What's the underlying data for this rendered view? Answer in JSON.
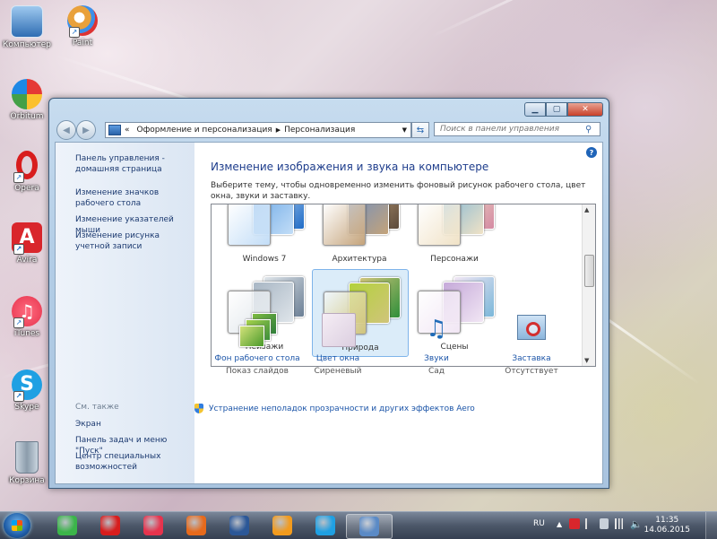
{
  "desktop": {
    "icons": [
      {
        "label": "Компьютер",
        "color": "#4a86c8"
      },
      {
        "label": "Paint",
        "color": "#e9a13b"
      },
      {
        "label": "Orbitum",
        "color": "#3bb54a"
      },
      {
        "label": "Opera",
        "color": "#d81d1d"
      },
      {
        "label": "Avira",
        "color": "#d9262c"
      },
      {
        "label": "iTunes",
        "color": "#e6334d"
      },
      {
        "label": "Skype",
        "color": "#1fa0e3"
      },
      {
        "label": "Корзина",
        "color": "#8b9cab"
      }
    ]
  },
  "window": {
    "address": {
      "chevrons": "«",
      "path1": "Оформление и персонализация",
      "sep": "▶",
      "path2": "Персонализация"
    },
    "search_placeholder": "Поиск в панели управления",
    "left_links": {
      "home": "Панель управления - домашняя страница",
      "icons": "Изменение значков рабочего стола",
      "pointers": "Изменение указателей мыши",
      "account": "Изменение рисунка учетной записи"
    },
    "see_also": {
      "title": "См. также",
      "screen": "Экран",
      "taskbar": "Панель задач и меню \"Пуск\"",
      "access": "Центр специальных возможностей"
    },
    "heading": "Изменение изображения и звука на компьютере",
    "description": "Выберите тему, чтобы одновременно изменить фоновый рисунок рабочего стола, цвет окна, звуки и заставку.",
    "themes": [
      {
        "name": "Windows 7",
        "colors": [
          "#1f6bc6",
          "#6aa7e6",
          "#c2ddf7"
        ],
        "selected": false
      },
      {
        "name": "Архитектура",
        "colors": [
          "#5b4a3b",
          "#6d8fc2",
          "#c4a37a"
        ],
        "selected": false
      },
      {
        "name": "Персонажи",
        "colors": [
          "#d48aa3",
          "#7fb6d6",
          "#f0e2c6"
        ],
        "selected": false
      },
      {
        "name": "Пейзажи",
        "colors": [
          "#6b7f95",
          "#a8b6c4",
          "#dfe5ea"
        ],
        "selected": false
      },
      {
        "name": "Природа",
        "colors": [
          "#2f8f3a",
          "#b3d23c",
          "#d0c47a"
        ],
        "selected": true
      },
      {
        "name": "Сцены",
        "colors": [
          "#7bb7d9",
          "#c5a9d9",
          "#f1e6f4"
        ],
        "selected": false
      }
    ],
    "options": [
      {
        "label": "Фон рабочего стола",
        "sub": "Показ слайдов",
        "icon": "desktop-background-icon"
      },
      {
        "label": "Цвет окна",
        "sub": "Сиреневый",
        "icon": "window-color-icon"
      },
      {
        "label": "Звуки",
        "sub": "Сад",
        "icon": "sounds-icon"
      },
      {
        "label": "Заставка",
        "sub": "Отсутствует",
        "icon": "screensaver-icon"
      }
    ],
    "aero_link": "Устранение неполадок прозрачности и других эффектов Aero"
  },
  "taskbar": {
    "items": [
      {
        "name": "orbitum",
        "color": "#3bb54a",
        "active": false
      },
      {
        "name": "opera",
        "color": "#d81d1d",
        "active": false
      },
      {
        "name": "itunes",
        "color": "#e6334d",
        "active": false
      },
      {
        "name": "outlook",
        "color": "#e76a1c",
        "active": false
      },
      {
        "name": "word",
        "color": "#2b5797",
        "active": false
      },
      {
        "name": "media-player",
        "color": "#f29b1e",
        "active": false
      },
      {
        "name": "skype",
        "color": "#1fa0e3",
        "active": false
      },
      {
        "name": "control-panel",
        "color": "#5a8ac6",
        "active": true
      }
    ],
    "language": "RU",
    "time": "11:35",
    "date": "14.06.2015"
  }
}
